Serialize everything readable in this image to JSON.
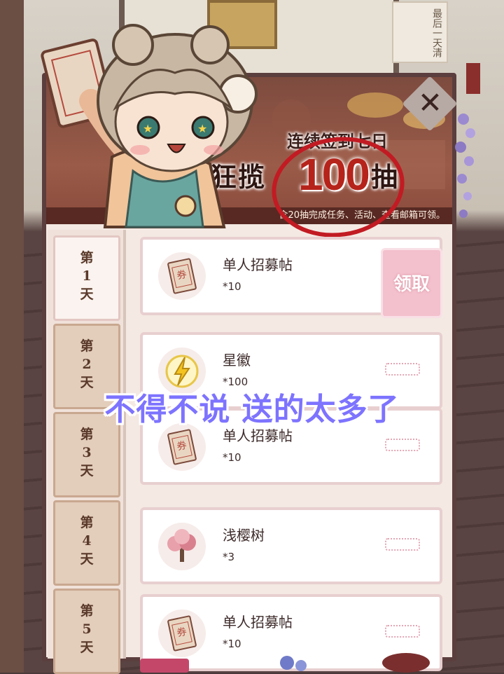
{
  "background": {
    "scroll_text": "最后一天清"
  },
  "banner": {
    "title_line1": "连续签到七日",
    "title_line2_prefix": "狂揽",
    "title_big_number": "100",
    "title_line2_suffix": "抽",
    "subtitle": "含20抽完成任务、活动、查看邮箱可领。"
  },
  "close_button": {
    "icon": "close-icon",
    "label": "✕"
  },
  "days": [
    {
      "prefix": "第",
      "number": "1",
      "suffix": "天",
      "active": true
    },
    {
      "prefix": "第",
      "number": "2",
      "suffix": "天",
      "active": false
    },
    {
      "prefix": "第",
      "number": "3",
      "suffix": "天",
      "active": false
    },
    {
      "prefix": "第",
      "number": "4",
      "suffix": "天",
      "active": false
    },
    {
      "prefix": "第",
      "number": "5",
      "suffix": "天",
      "active": false
    }
  ],
  "rewards": [
    {
      "name": "单人招募帖",
      "qty": "*10",
      "icon": "ticket-icon",
      "claim_label": "领取"
    },
    {
      "name": "星徽",
      "qty": "*100",
      "icon": "lightning-badge-icon"
    },
    {
      "name": "单人招募帖",
      "qty": "*10",
      "icon": "ticket-icon"
    },
    {
      "name": "浅樱树",
      "qty": "*3",
      "icon": "cherry-tree-icon"
    },
    {
      "name": "单人招募帖",
      "qty": "*10",
      "icon": "ticket-icon"
    }
  ],
  "caption": "不得不说 送的太多了",
  "colors": {
    "caption": "#7d73ff",
    "claim_button": "#f3c0cd",
    "highlight_circle": "#c21b23",
    "panel_border": "#5b3e3e"
  }
}
